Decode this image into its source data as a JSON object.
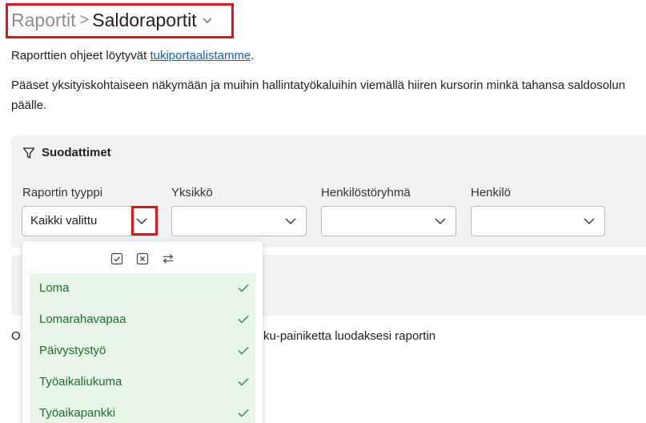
{
  "breadcrumb": {
    "parent": "Raportit",
    "separator": ">",
    "current": "Saldoraportit"
  },
  "intro": {
    "text_before_link": "Raporttien ohjeet löytyvät ",
    "link_text": "tukiportaalistamme",
    "text_after_link": "."
  },
  "description": "Pääset yksityiskohtaiseen näkymään ja muihin hallintatyökaluihin viemällä hiiren kursorin minkä tahansa saldosolun päälle.",
  "filters": {
    "title": "Suodattimet",
    "fields": [
      {
        "label": "Raportin tyyppi",
        "value": "Kaikki valittu"
      },
      {
        "label": "Yksikkö",
        "value": ""
      },
      {
        "label": "Henkilöstöryhmä",
        "value": ""
      },
      {
        "label": "Henkilö",
        "value": ""
      }
    ]
  },
  "hint": {
    "visible_start": "O",
    "visible_end": "ku-painiketta luodaksesi raportin"
  },
  "dropdown": {
    "tools": [
      "select-all-icon",
      "clear-all-icon",
      "swap-selection-icon"
    ],
    "options": [
      {
        "label": "Loma",
        "selected": true
      },
      {
        "label": "Lomarahavapaa",
        "selected": true
      },
      {
        "label": "Päivystystyö",
        "selected": true
      },
      {
        "label": "Työaikaliukuma",
        "selected": true
      },
      {
        "label": "Työaikapankki",
        "selected": true
      }
    ]
  },
  "colors": {
    "accent_link": "#0b63c5",
    "selected_bg": "#e7f6e9",
    "selected_text": "#1f6e2a",
    "highlight_red": "#e3131c",
    "panel_bg": "#f1f2f3"
  }
}
